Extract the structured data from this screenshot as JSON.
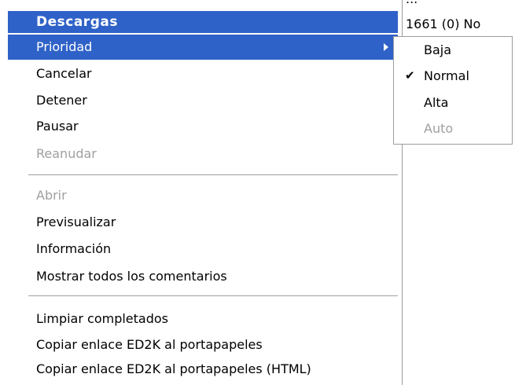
{
  "background_list": {
    "rows": [
      "...",
      "1661 (0)    No"
    ]
  },
  "menu": {
    "title": "Descargas",
    "items": [
      {
        "label": "Prioridad",
        "enabled": true,
        "highlighted": true,
        "has_submenu": true
      },
      {
        "label": "Cancelar",
        "enabled": true
      },
      {
        "label": "Detener",
        "enabled": true
      },
      {
        "label": "Pausar",
        "enabled": true
      },
      {
        "label": "Reanudar",
        "enabled": false
      },
      {
        "label": "Abrir",
        "enabled": false
      },
      {
        "label": "Previsualizar",
        "enabled": true
      },
      {
        "label": "Información",
        "enabled": true
      },
      {
        "label": "Mostrar todos los comentarios",
        "enabled": true
      },
      {
        "label": "Limpiar completados",
        "enabled": true
      },
      {
        "label": "Copiar enlace ED2K al portapapeles",
        "enabled": true
      },
      {
        "label": "Copiar enlace ED2K al portapapeles (HTML)",
        "enabled": true
      }
    ]
  },
  "submenu": {
    "items": [
      {
        "label": "Baja",
        "enabled": true,
        "checked": false
      },
      {
        "label": "Normal",
        "enabled": true,
        "checked": true
      },
      {
        "label": "Alta",
        "enabled": true,
        "checked": false
      },
      {
        "label": "Auto",
        "enabled": false,
        "checked": false
      }
    ],
    "check_glyph": "✔"
  },
  "colors": {
    "highlight": "#2f62c8",
    "disabled_text": "#a0a0a0"
  }
}
